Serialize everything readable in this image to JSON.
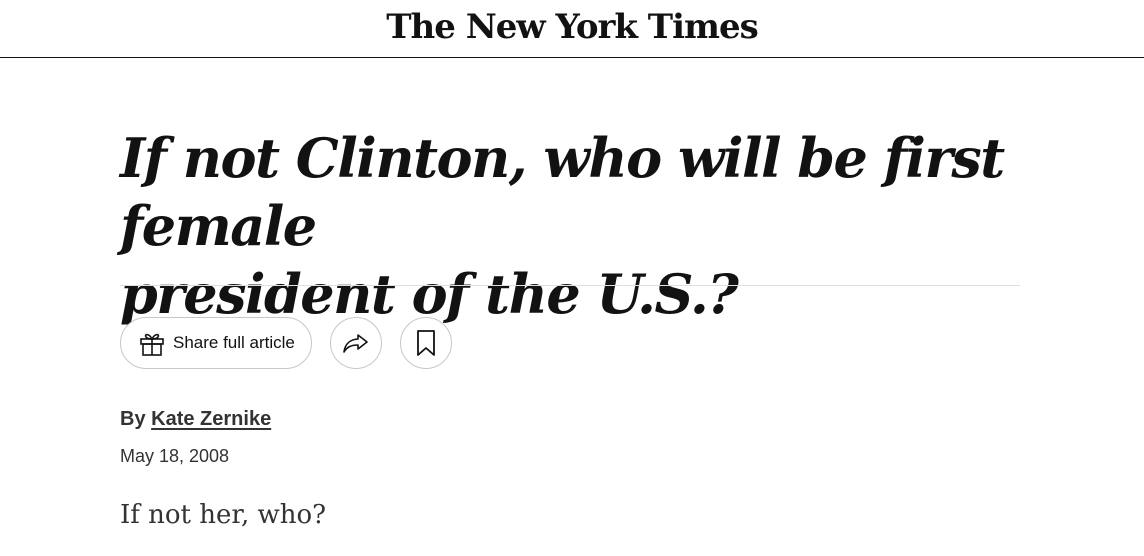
{
  "masthead": {
    "logo_text": "The New York Times"
  },
  "article": {
    "headline_line1": "If not Clinton, who will be first female",
    "headline_line2": "president of the U.S.?",
    "byline_prefix": "By",
    "author": "Kate Zernike",
    "date": "May 18, 2008",
    "first_paragraph": "If not her, who?"
  },
  "actions": {
    "share_full_label": "Share full article",
    "share_icon": "share-arrow-icon",
    "bookmark_icon": "bookmark-icon",
    "gift_icon": "gift-icon"
  },
  "colors": {
    "text": "#121212",
    "secondary_text": "#333333",
    "border": "#c7c7c7",
    "rule": "#dfdfdf"
  }
}
